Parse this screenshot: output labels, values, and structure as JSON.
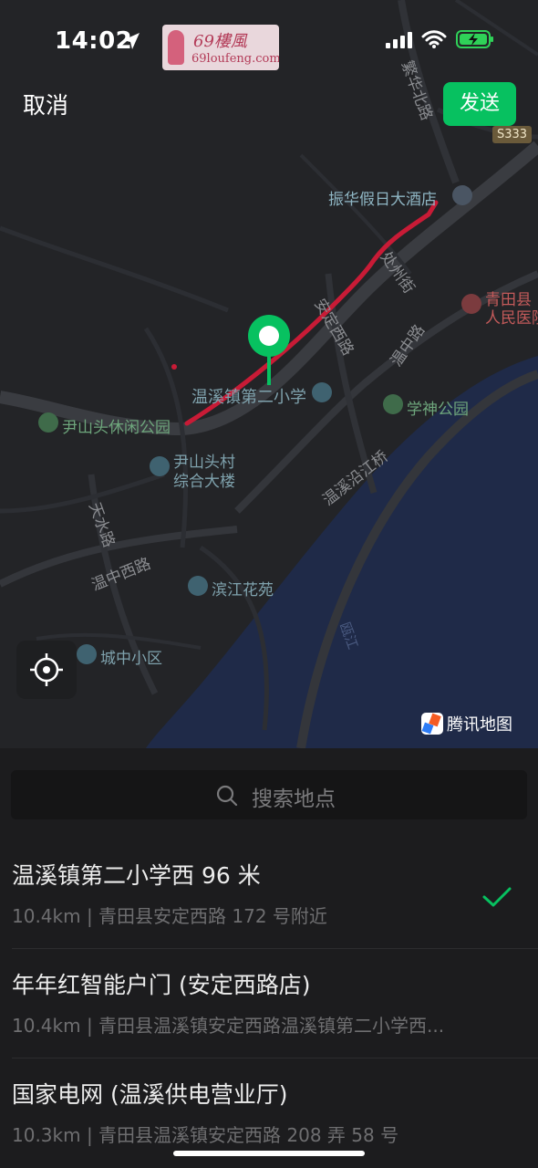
{
  "status_bar": {
    "time": "14:02"
  },
  "watermark": {
    "line1": "69樓風",
    "line2": "69loufeng.com"
  },
  "header": {
    "cancel_label": "取消",
    "send_label": "发送"
  },
  "map": {
    "road_sign": "S333",
    "labels": [
      {
        "text": "振华假日大酒店"
      },
      {
        "text": "青田县"
      },
      {
        "text": "人民医院"
      },
      {
        "text": "温溪镇第二小学"
      },
      {
        "text": "学神公园"
      },
      {
        "text": "尹山头休闲公园"
      },
      {
        "text": "尹山头村"
      },
      {
        "text": "综合大楼"
      },
      {
        "text": "滨江花苑"
      },
      {
        "text": "城中小区"
      },
      {
        "text": "温中西路"
      },
      {
        "text": "繁华北路"
      },
      {
        "text": "处州街"
      },
      {
        "text": "安定西路"
      },
      {
        "text": "温中路"
      },
      {
        "text": "温溪沿江桥"
      },
      {
        "text": "天水路"
      },
      {
        "text": "瓯江"
      }
    ],
    "brand": "腾讯地图"
  },
  "search": {
    "placeholder": "搜索地点"
  },
  "results": [
    {
      "title": "温溪镇第二小学西 96 米",
      "subtitle": "10.4km | 青田县安定西路 172 号附近",
      "selected": true
    },
    {
      "title": "年年红智能户门 (安定西路店)",
      "subtitle": "10.4km | 青田县温溪镇安定西路温溪镇第二小学西...",
      "selected": false
    },
    {
      "title": "国家电网 (温溪供电营业厅)",
      "subtitle": "10.3km | 青田县温溪镇安定西路 208 弄 58 号",
      "selected": false
    }
  ],
  "colors": {
    "accent": "#07c160",
    "route": "#d11f3a",
    "river": "#1d2a4a"
  }
}
